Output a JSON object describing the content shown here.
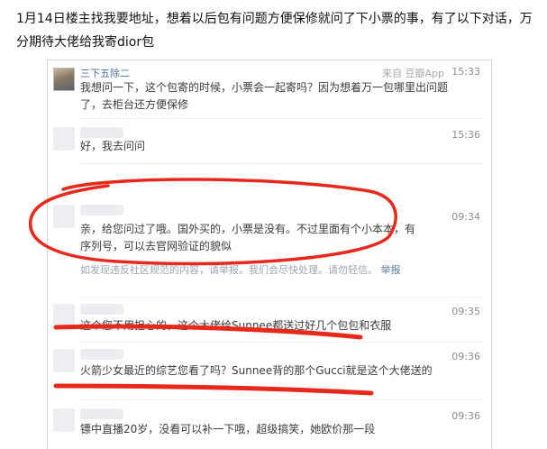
{
  "intro_text": "1月14日楼主找我要地址，想着以后包有问题方便保修就问了下小票的事，有了以下对话，万分期待大佬给我寄dior包",
  "messages": [
    {
      "name": "三下五除二",
      "source": "来自 豆瓣App",
      "time": "15:33",
      "text": "我想问一下，这个包寄的时候，小票会一起寄吗？因为想着万一包哪里出问题了，去柜台还方便保修"
    },
    {
      "name": "",
      "time": "15:36",
      "text": "好，我去问问"
    },
    {
      "name": "",
      "time": "09:34",
      "text": "亲，给您问过了哦。国外买的，小票是没有。不过里面有个小本本，有序列号，可以去官网验证的貌似"
    },
    {
      "faded_text": "如发现违反社区规范的内容，请举报。我们会尽快处理。请勿轻信。",
      "report_label": "举报"
    },
    {
      "name": "",
      "time": "09:35",
      "text": "这个您不用担心的，这个大佬给Sunnee都送过好几个包包和衣服"
    },
    {
      "name": "",
      "time": "09:36",
      "text": "火箭少女最近的综艺您看了吗？Sunnee背的那个Gucci就是这个大佬送的"
    },
    {
      "name": "",
      "time": "09:36",
      "text": "镖中直播20岁，没看可以补一下哦，超级搞笑，她欧价那一段"
    }
  ],
  "colors": {
    "marker_red": "#e8281b",
    "name_blue": "#4a6f98",
    "time_gray": "#8c8c8c"
  }
}
